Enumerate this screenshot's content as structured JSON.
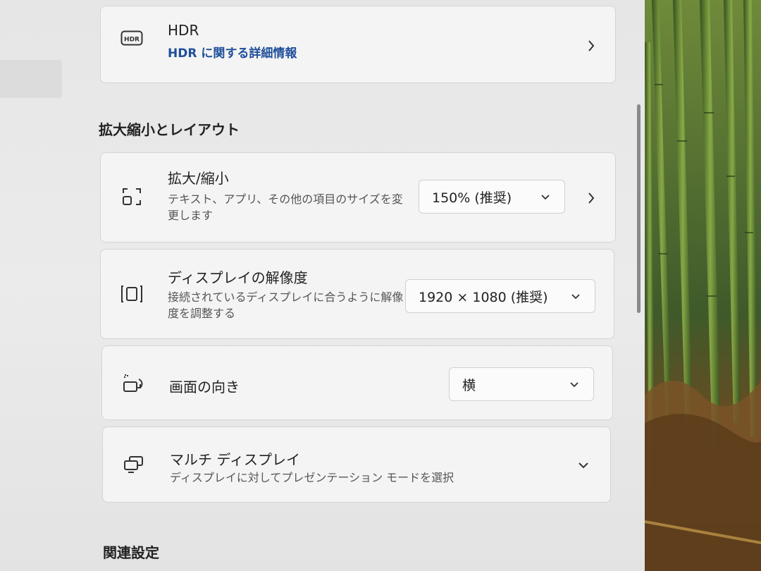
{
  "hdr": {
    "icon_text": "HDR",
    "title": "HDR",
    "link": "HDR に関する詳細情報"
  },
  "section": {
    "title": "拡大縮小とレイアウト"
  },
  "scale": {
    "title": "拡大/縮小",
    "subtitle": "テキスト、アプリ、その他の項目のサイズを変更します",
    "value": "150% (推奨)"
  },
  "resolution": {
    "title": "ディスプレイの解像度",
    "subtitle": "接続されているディスプレイに合うように解像度を調整する",
    "value": "1920 × 1080 (推奨)"
  },
  "orientation": {
    "title": "画面の向き",
    "value": "横"
  },
  "multi": {
    "title": "マルチ ディスプレイ",
    "subtitle": "ディスプレイに対してプレゼンテーション モードを選択"
  },
  "related": {
    "title": "関連設定"
  }
}
